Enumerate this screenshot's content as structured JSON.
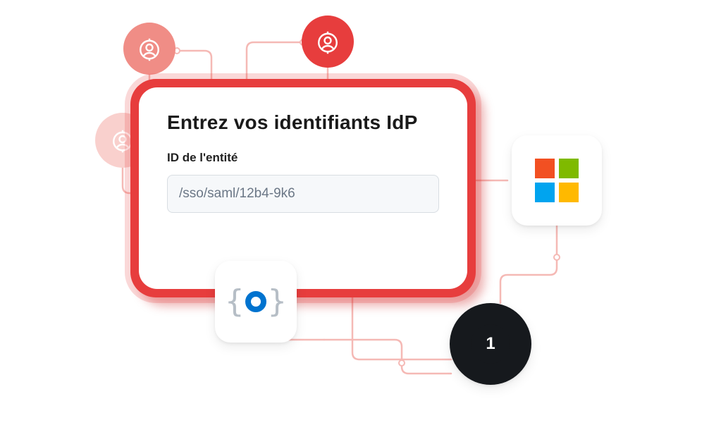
{
  "card": {
    "title": "Entrez vos identifiants IdP",
    "field_label": "ID de l'entité",
    "field_value": "/sso/saml/12b4-9k6"
  },
  "avatars": {
    "a1": "user-icon",
    "a2": "user-icon",
    "a3": "user-icon"
  },
  "tiles": {
    "microsoft": "microsoft-logo-icon",
    "okta": "okta-logo-icon",
    "onelogin": "onelogin-logo-icon",
    "onelogin_label": "1"
  },
  "colors": {
    "red": "#E73D3D",
    "pink_line": "#F5B9B5",
    "input_text": "#6B7786",
    "blue": "#0073CF",
    "dark": "#16191D"
  }
}
